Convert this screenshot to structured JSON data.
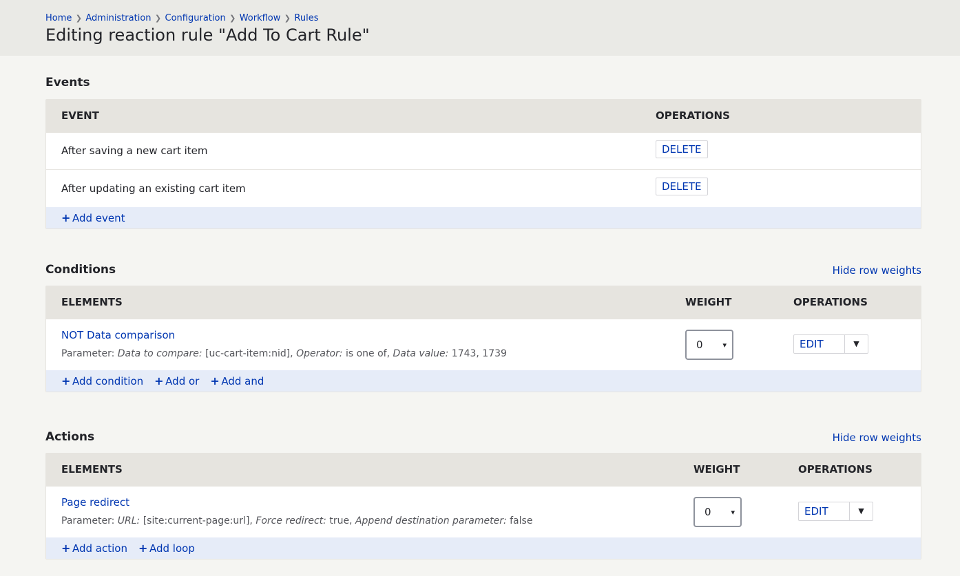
{
  "breadcrumb": [
    "Home",
    "Administration",
    "Configuration",
    "Workflow",
    "Rules"
  ],
  "page_title": "Editing reaction rule \"Add To Cart Rule\"",
  "events": {
    "title": "Events",
    "columns": {
      "event": "EVENT",
      "operations": "OPERATIONS"
    },
    "rows": [
      {
        "label": "After saving a new cart item",
        "op": "DELETE"
      },
      {
        "label": "After updating an existing cart item",
        "op": "DELETE"
      }
    ],
    "add_event": "Add event"
  },
  "conditions": {
    "title": "Conditions",
    "hide_weights": "Hide row weights",
    "columns": {
      "elements": "ELEMENTS",
      "weight": "WEIGHT",
      "operations": "OPERATIONS"
    },
    "rows": [
      {
        "name": "NOT Data comparison",
        "param_prefix": "Parameter:",
        "k1": "Data to compare:",
        "v1": "[uc-cart-item:nid],",
        "k2": "Operator:",
        "v2": "is one of,",
        "k3": "Data value:",
        "v3": "1743, 1739",
        "weight": "0",
        "op": "EDIT"
      }
    ],
    "add_condition": "Add condition",
    "add_or": "Add or",
    "add_and": "Add and"
  },
  "actions": {
    "title": "Actions",
    "hide_weights": "Hide row weights",
    "columns": {
      "elements": "ELEMENTS",
      "weight": "WEIGHT",
      "operations": "OPERATIONS"
    },
    "rows": [
      {
        "name": "Page redirect",
        "param_prefix": "Parameter:",
        "k1": "URL:",
        "v1": "[site:current-page:url],",
        "k2": "Force redirect:",
        "v2": "true,",
        "k3": "Append destination parameter:",
        "v3": "false",
        "weight": "0",
        "op": "EDIT"
      }
    ],
    "add_action": "Add action",
    "add_loop": "Add loop"
  }
}
